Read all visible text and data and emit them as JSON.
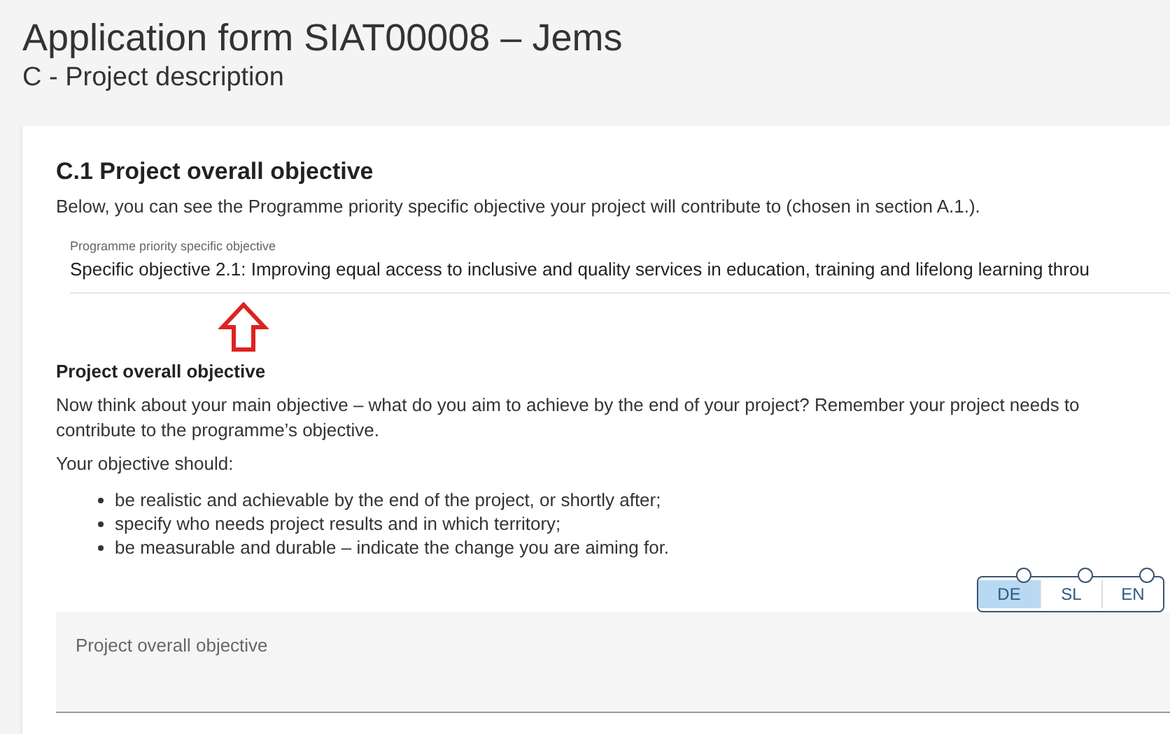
{
  "page": {
    "title": "Application form SIAT00008 – Jems",
    "subtitle": "C - Project description"
  },
  "section": {
    "heading": "C.1 Project overall objective",
    "intro": "Below, you can see the Programme priority specific objective your project will contribute to (chosen in section A.1.).",
    "readonly_field": {
      "label": "Programme priority specific objective",
      "value": "Specific objective 2.1: Improving equal access to inclusive and quality services in education, training and lifelong learning throu"
    },
    "subheading": "Project overall objective",
    "paragraphs": [
      "Now think about your main objective – what do you aim to achieve by the end of your project? Remember your project needs to contribute to the programme’s objective.",
      "Your objective should:"
    ],
    "bullets": [
      "be realistic and achievable by the end of the project, or shortly after;",
      "specify who needs project results and in which territory;",
      "be measurable and durable – indicate the change you are aiming for."
    ],
    "languages": [
      {
        "label": "DE",
        "selected": true
      },
      {
        "label": "SL",
        "selected": false
      },
      {
        "label": "EN",
        "selected": false
      }
    ],
    "textarea": {
      "placeholder": "Project overall objective"
    }
  }
}
